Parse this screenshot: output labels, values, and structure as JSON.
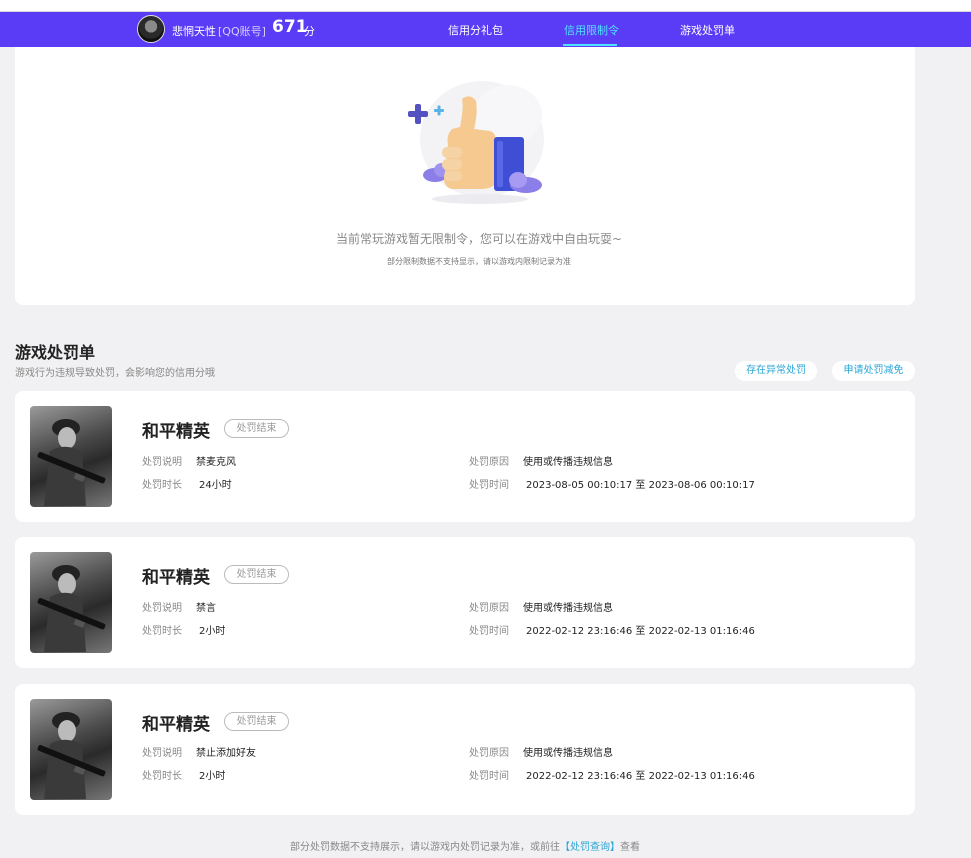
{
  "header": {
    "user_name": "悲惘天性",
    "account_type": "[QQ账号]",
    "score": "671",
    "score_unit": "分",
    "tabs": [
      {
        "label": "信用分礼包",
        "active": false
      },
      {
        "label": "信用限制令",
        "active": true
      },
      {
        "label": "游戏处罚单",
        "active": false
      }
    ],
    "accent_color": "#5b3cf6",
    "active_tab_color": "#4fe3ff"
  },
  "restriction": {
    "empty_message": "当前常玩游戏暂无限制令，您可以在游戏中自由玩耍~",
    "sub_note": "部分限制数据不支持显示，请以游戏内限制记录为准",
    "illustration_icon": "thumbs-up-icon"
  },
  "penalties": {
    "title": "游戏处罚单",
    "subtitle": "游戏行为违规导致处罚，会影响您的信用分哦",
    "buttons": {
      "appeal_anomaly": "存在异常处罚",
      "apply_reduction": "申请处罚减免"
    },
    "labels": {
      "description": "处罚说明",
      "duration": "处罚时长",
      "reason": "处罚原因",
      "time": "处罚时间",
      "to": "至"
    },
    "items": [
      {
        "game": "和平精英",
        "status": "处罚结束",
        "description": "禁麦克风",
        "duration": "24小时",
        "reason": "使用或传播违规信息",
        "start": "2023-08-05 00:10:17",
        "end": "2023-08-06 00:10:17"
      },
      {
        "game": "和平精英",
        "status": "处罚结束",
        "description": "禁言",
        "duration": "2小时",
        "reason": "使用或传播违规信息",
        "start": "2022-02-12 23:16:46",
        "end": "2022-02-13 01:16:46"
      },
      {
        "game": "和平精英",
        "status": "处罚结束",
        "description": "禁止添加好友",
        "duration": "2小时",
        "reason": "使用或传播违规信息",
        "start": "2022-02-12 23:16:46",
        "end": "2022-02-13 01:16:46"
      }
    ]
  },
  "footer": {
    "note_prefix": "部分处罚数据不支持展示，请以游戏内处罚记录为准，或前往",
    "link": "【处罚查询】",
    "note_suffix": "查看"
  }
}
